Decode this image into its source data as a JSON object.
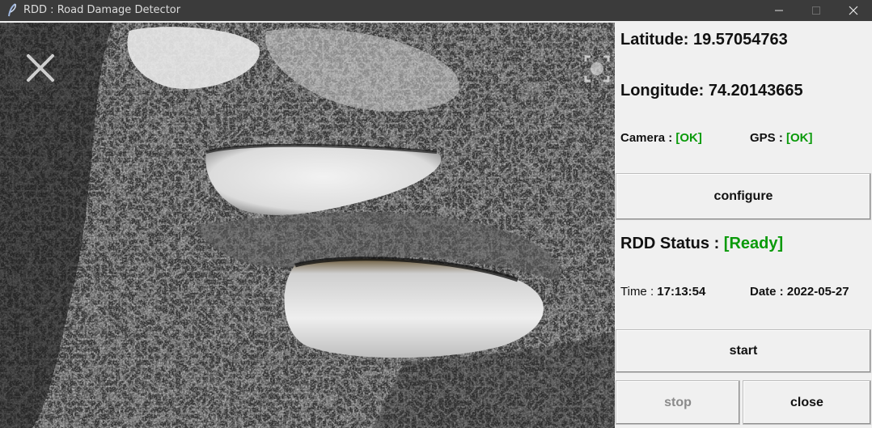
{
  "window": {
    "title": "RDD : Road Damage Detector",
    "icons": [
      "feather-icon",
      "minimize-icon",
      "maximize-icon",
      "close-icon"
    ]
  },
  "feed": {
    "overlay_icons": [
      "close-icon",
      "camera-switch-icon"
    ]
  },
  "panel": {
    "latitude_label": "Latitude:",
    "latitude_value": "19.57054763",
    "longitude_label": "Longitude:",
    "longitude_value": "74.20143665",
    "camera_label": "Camera :",
    "camera_status": "[OK]",
    "gps_label": "GPS :",
    "gps_status": "[OK]",
    "configure_label": "configure",
    "rdd_status_label": "RDD Status :",
    "rdd_status_value": "[Ready]",
    "time_label": "Time :",
    "time_value": "17:13:54",
    "date_label": "Date :",
    "date_value": "2022-05-27",
    "start_label": "start",
    "stop_label": "stop",
    "close_label": "close"
  },
  "colors": {
    "ok": "#0a9a0a",
    "titlebar": "#3b3b3b",
    "panel": "#f0f0f0"
  }
}
